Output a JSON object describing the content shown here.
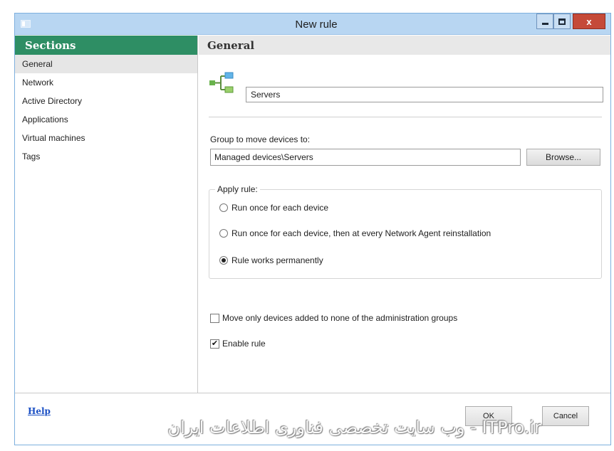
{
  "window": {
    "title": "New rule"
  },
  "sidebar": {
    "header": "Sections",
    "items": [
      {
        "label": "General",
        "active": true
      },
      {
        "label": "Network"
      },
      {
        "label": "Active Directory"
      },
      {
        "label": "Applications"
      },
      {
        "label": "Virtual machines"
      },
      {
        "label": "Tags"
      }
    ]
  },
  "general": {
    "header": "General",
    "rule_name": "Servers",
    "group_label": "Group to move devices to:",
    "group_value": "Managed devices\\Servers",
    "browse_label": "Browse...",
    "apply_legend": "Apply rule:",
    "options": [
      {
        "label": "Run once for each device",
        "checked": false
      },
      {
        "label": "Run once for each device, then at every Network Agent reinstallation",
        "checked": false
      },
      {
        "label": "Rule works permanently",
        "checked": true
      }
    ],
    "move_only_label": "Move only devices added to none of the administration groups",
    "move_only_checked": false,
    "enable_label": "Enable rule",
    "enable_checked": true
  },
  "footer": {
    "help": "Help",
    "ok": "OK",
    "cancel": "Cancel"
  },
  "watermark": "ITPro.ir - وب سایت تخصصی فناوری اطلاعات ایران",
  "colors": {
    "sidebar_header": "#2e8e64",
    "titlebar": "#b8d6f2",
    "close": "#c54a39",
    "link": "#1a4fc4"
  }
}
